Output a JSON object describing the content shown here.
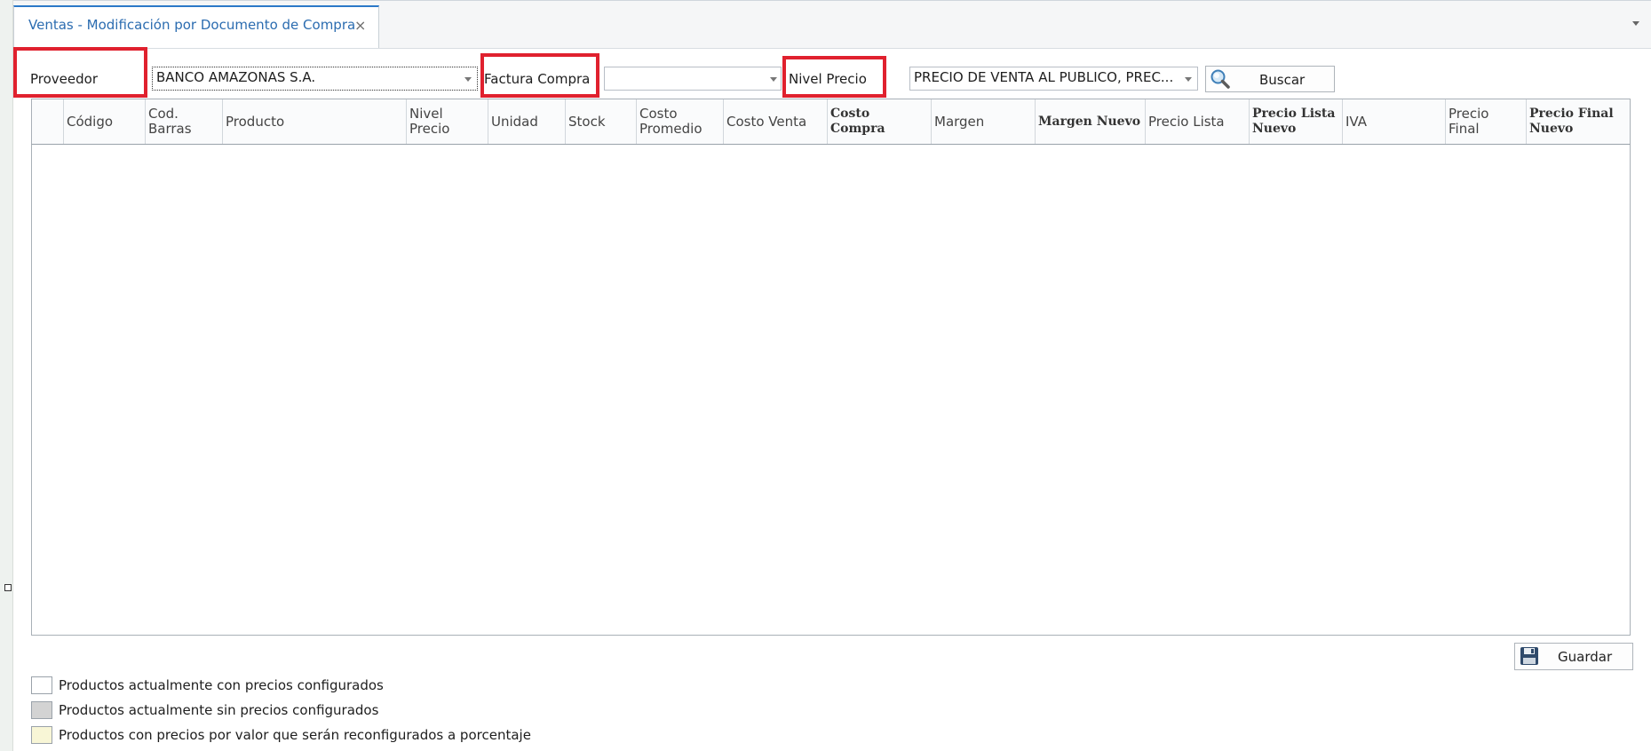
{
  "tab": {
    "title": "Ventas - Modificación por Documento de Compra",
    "close": "×"
  },
  "filters": {
    "proveedor": {
      "label": "Proveedor",
      "value": "BANCO AMAZONAS S.A."
    },
    "factura": {
      "label": "Factura Compra",
      "value": ""
    },
    "nivel": {
      "label": "Nivel Precio",
      "value": "PRECIO DE VENTA AL PUBLICO, PREC..."
    },
    "buscar_label": "Buscar",
    "search_icon": "magnifier-icon"
  },
  "grid": {
    "columns": [
      {
        "label": "Código",
        "bold": false
      },
      {
        "label": "Cod. Barras",
        "bold": false
      },
      {
        "label": "Producto",
        "bold": false
      },
      {
        "label": "Nivel Precio",
        "bold": false
      },
      {
        "label": "Unidad",
        "bold": false
      },
      {
        "label": "Stock",
        "bold": false
      },
      {
        "label": "Costo Promedio",
        "bold": false
      },
      {
        "label": "Costo Venta",
        "bold": false
      },
      {
        "label": "Costo Compra",
        "bold": true
      },
      {
        "label": "Margen",
        "bold": false
      },
      {
        "label": "Margen Nuevo",
        "bold": true
      },
      {
        "label": "Precio Lista",
        "bold": false
      },
      {
        "label": "Precio Lista Nuevo",
        "bold": true
      },
      {
        "label": "IVA",
        "bold": false
      },
      {
        "label": "Precio Final",
        "bold": false
      },
      {
        "label": "Precio Final Nuevo",
        "bold": true
      }
    ],
    "rows": []
  },
  "guardar_label": "Guardar",
  "save_icon": "floppy-disk-icon",
  "legend": [
    {
      "text": "Productos actualmente con precios configurados",
      "color": "#ffffff"
    },
    {
      "text": "Productos actualmente sin precios configurados",
      "color": "#d3d3d3"
    },
    {
      "text": "Productos con precios por valor que serán reconfigurados a porcentaje",
      "color": "#f8f6d6"
    }
  ],
  "colors": {
    "accent": "#2b6cb0",
    "highlight": "#e0212e"
  }
}
